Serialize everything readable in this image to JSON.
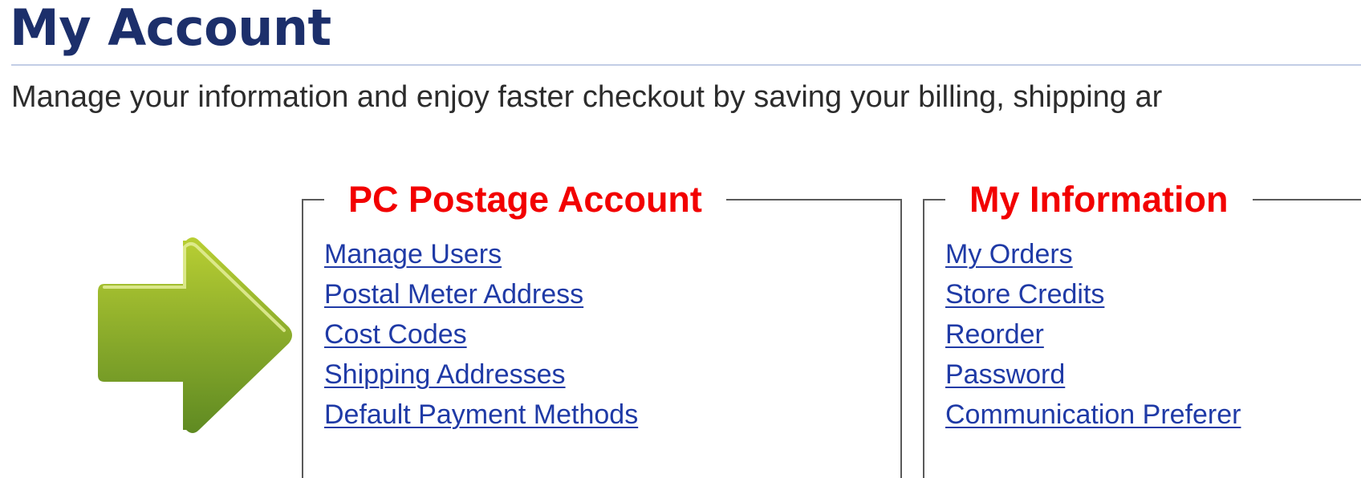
{
  "header": {
    "title": "My Account",
    "intro": "Manage your information and enjoy faster checkout by saving your billing, shipping ar"
  },
  "panels": [
    {
      "title": "PC Postage Account",
      "links": [
        "Manage Users",
        "Postal Meter Address",
        "Cost Codes",
        "Shipping Addresses",
        "Default Payment Methods"
      ]
    },
    {
      "title": "My Information",
      "links": [
        "My Orders",
        "Store Credits",
        "Reorder",
        "Password",
        "Communication Preferer"
      ]
    }
  ],
  "decoration": {
    "arrow_icon": "right-arrow-icon",
    "arrow_color": "#8aaa28"
  },
  "colors": {
    "title": "#1c2f6b",
    "panel_heading": "#f20000",
    "link": "#1f3aa6"
  }
}
